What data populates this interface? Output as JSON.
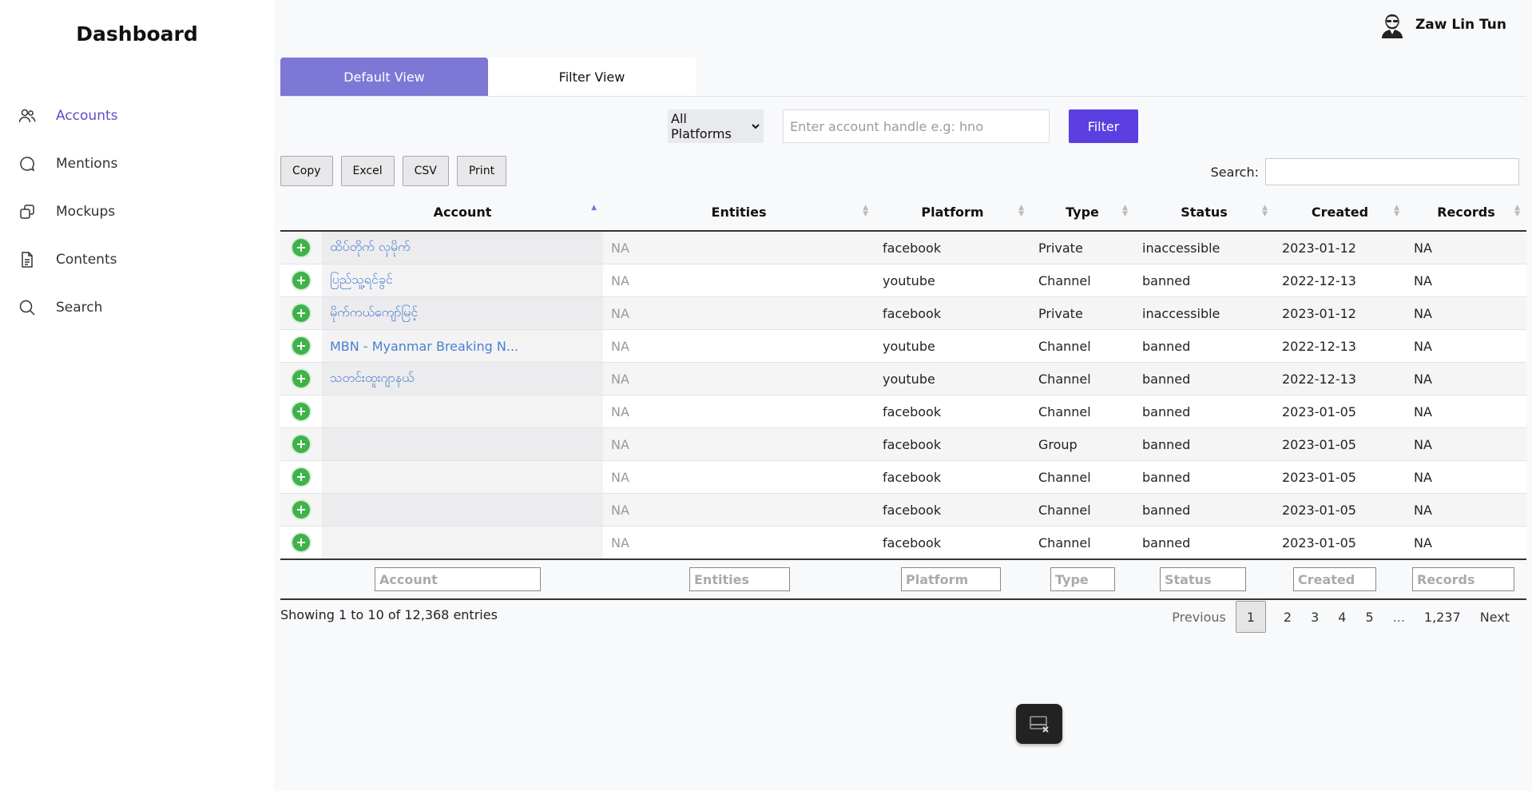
{
  "sidebar": {
    "title": "Dashboard",
    "items": [
      {
        "label": "Accounts",
        "icon": "users-icon",
        "active": true
      },
      {
        "label": "Mentions",
        "icon": "chat-icon",
        "active": false
      },
      {
        "label": "Mockups",
        "icon": "copy-icon",
        "active": false
      },
      {
        "label": "Contents",
        "icon": "document-icon",
        "active": false
      },
      {
        "label": "Search",
        "icon": "search-icon",
        "active": false
      }
    ]
  },
  "header": {
    "user_name": "Zaw Lin Tun",
    "avatar_icon": "avatar-icon"
  },
  "tabs": [
    {
      "label": "Default View",
      "active": true
    },
    {
      "label": "Filter View",
      "active": false
    }
  ],
  "filter": {
    "platform_selected": "All Platforms",
    "handle_placeholder": "Enter account handle e.g: hno",
    "button_label": "Filter"
  },
  "export_buttons": [
    "Copy",
    "Excel",
    "CSV",
    "Print"
  ],
  "search": {
    "label": "Search:"
  },
  "table": {
    "columns": [
      "Account",
      "Entities",
      "Platform",
      "Type",
      "Status",
      "Created",
      "Records"
    ],
    "rows": [
      {
        "account": "ထိပ်တိုက် လှမိုက်",
        "entities": "NA",
        "platform": "facebook",
        "type": "Private",
        "status": "inaccessible",
        "created": "2023-01-12",
        "records": "NA"
      },
      {
        "account": "ပြည်သူ့ရင်ခွင်",
        "entities": "NA",
        "platform": "youtube",
        "type": "Channel",
        "status": "banned",
        "created": "2022-12-13",
        "records": "NA"
      },
      {
        "account": "မိုက်ကယ်ကျော်မြင့်",
        "entities": "NA",
        "platform": "facebook",
        "type": "Private",
        "status": "inaccessible",
        "created": "2023-01-12",
        "records": "NA"
      },
      {
        "account": "MBN - Myanmar Breaking N...",
        "entities": "NA",
        "platform": "youtube",
        "type": "Channel",
        "status": "banned",
        "created": "2022-12-13",
        "records": "NA"
      },
      {
        "account": "သတင်းထူးဂျာနယ်",
        "entities": "NA",
        "platform": "youtube",
        "type": "Channel",
        "status": "banned",
        "created": "2022-12-13",
        "records": "NA"
      },
      {
        "account": "",
        "entities": "NA",
        "platform": "facebook",
        "type": "Channel",
        "status": "banned",
        "created": "2023-01-05",
        "records": "NA"
      },
      {
        "account": "",
        "entities": "NA",
        "platform": "facebook",
        "type": "Group",
        "status": "banned",
        "created": "2023-01-05",
        "records": "NA"
      },
      {
        "account": "",
        "entities": "NA",
        "platform": "facebook",
        "type": "Channel",
        "status": "banned",
        "created": "2023-01-05",
        "records": "NA"
      },
      {
        "account": "",
        "entities": "NA",
        "platform": "facebook",
        "type": "Channel",
        "status": "banned",
        "created": "2023-01-05",
        "records": "NA"
      },
      {
        "account": "",
        "entities": "NA",
        "platform": "facebook",
        "type": "Channel",
        "status": "banned",
        "created": "2023-01-05",
        "records": "NA"
      }
    ],
    "footer_placeholders": [
      "Account",
      "Entities",
      "Platform",
      "Type",
      "Status",
      "Created",
      "Records"
    ]
  },
  "info": "Showing 1 to 10 of 12,368 entries",
  "pagination": {
    "previous": "Previous",
    "pages": [
      "1",
      "2",
      "3",
      "4",
      "5"
    ],
    "ellipsis": "...",
    "last": "1,237",
    "next": "Next",
    "current": "1"
  },
  "colors": {
    "accent": "#5b3fe0",
    "active_tab": "#7d78d6",
    "nav_active": "#5b4fc9",
    "link": "#4a7fd0",
    "expand": "#3fb24a"
  }
}
